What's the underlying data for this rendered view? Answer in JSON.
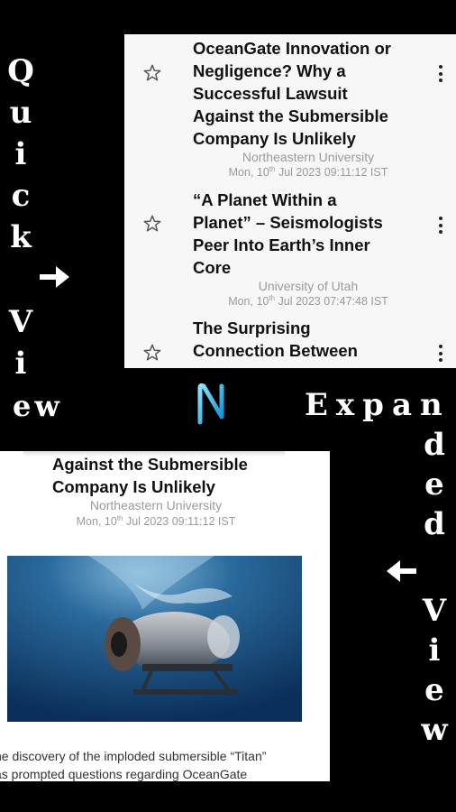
{
  "labels": {
    "quick_letters": [
      "Q",
      "u",
      "i",
      "c",
      "k"
    ],
    "view_letters_left": [
      "V",
      "i"
    ],
    "view_tail_left": "ew",
    "expanded_row": "Expan",
    "expanded_letters": [
      "d",
      "e",
      "d"
    ],
    "view_letters_right": [
      "V",
      "i",
      "e",
      "w"
    ]
  },
  "logo": {
    "letter": "N",
    "color": "#1fb6e8"
  },
  "quick_view": {
    "items": [
      {
        "title_lines": [
          "OceanGate Innovation or",
          "Negligence? Why a",
          "Successful Lawsuit",
          "Against the Submersible",
          "Company Is Unlikely"
        ],
        "source": "Northeastern University",
        "date_prefix": "Mon, 10",
        "date_sup": "th",
        "date_suffix": " Jul 2023 09:11:12 IST"
      },
      {
        "title_lines": [
          "“A Planet Within a",
          "Planet” – Seismologists",
          "Peer Into Earth’s Inner",
          "Core"
        ],
        "source": "University of Utah",
        "date_prefix": "Mon, 10",
        "date_sup": "th",
        "date_suffix": " Jul 2023 07:47:48 IST"
      },
      {
        "title_lines": [
          "The Surprising",
          "Connection Between"
        ]
      }
    ],
    "star_icon": "star-outline-icon",
    "menu_icon": "kebab-menu-icon"
  },
  "expanded_view": {
    "title_lines": [
      "Against the Submersible",
      "Company Is Unlikely"
    ],
    "source": "Northeastern University",
    "date_prefix": "Mon, 10",
    "date_sup": "th",
    "date_suffix": " Jul 2023 09:11:12 IST",
    "image": "submersible-underwater-photo",
    "body_lines": [
      "he discovery of the imploded submersible “Titan”",
      "as prompted questions regarding OceanGate"
    ]
  }
}
